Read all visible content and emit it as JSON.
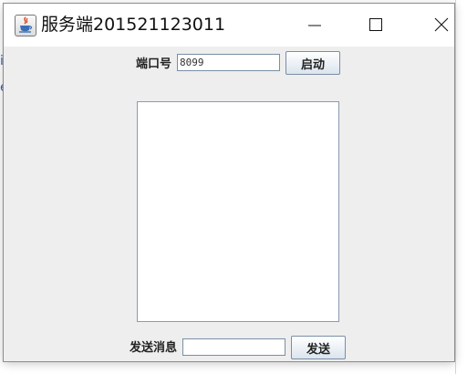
{
  "window": {
    "title": "服务端201521123011",
    "controls": [
      "minimize",
      "maximize",
      "close"
    ]
  },
  "background": {
    "edge_chars": [
      "i",
      "e"
    ]
  },
  "server": {
    "port_label": "端口号",
    "port_value": "8099",
    "start_button": "启动"
  },
  "log": {
    "content": ""
  },
  "send": {
    "label": "发送消息",
    "message_value": "",
    "send_button": "发送"
  },
  "icons": {
    "app": "java-coffee-cup-icon",
    "minimize": "minimize-icon",
    "maximize": "maximize-icon",
    "close": "close-icon"
  }
}
